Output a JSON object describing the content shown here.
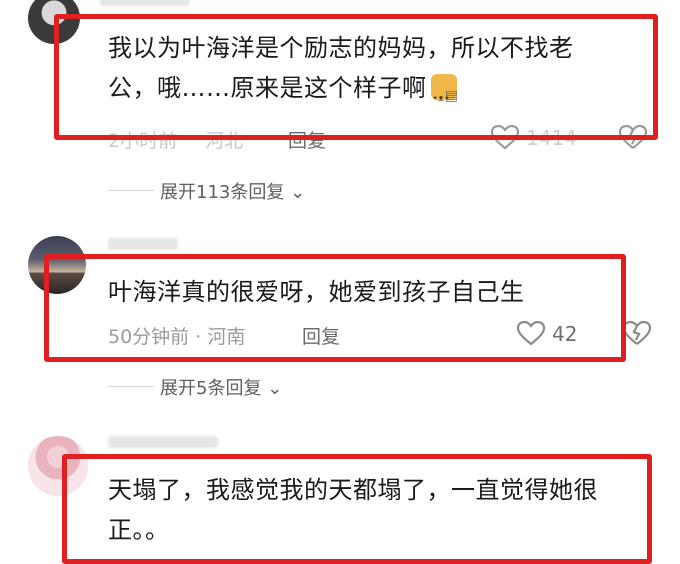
{
  "comments": [
    {
      "text_line1": "我以为叶海洋是个励志的妈妈，所以不找老",
      "text_line2": "公，哦……原来是这个样子啊",
      "time": "2小时前",
      "location": "河北",
      "reply_label": "回复",
      "likes": "1414",
      "expand_label": "展开113条回复"
    },
    {
      "text_line1": "叶海洋真的很爱呀，她爱到孩子自己生",
      "time": "50分钟前",
      "location": "河南",
      "separator": "·",
      "reply_label": "回复",
      "likes": "42",
      "expand_label": "展开5条回复"
    },
    {
      "text_line1": "天塌了，我感觉我的天都塌了，一直觉得她很",
      "text_line2": "正。。"
    }
  ],
  "colors": {
    "highlight_box": "#e02020",
    "meta_text": "#9b9b9b"
  }
}
